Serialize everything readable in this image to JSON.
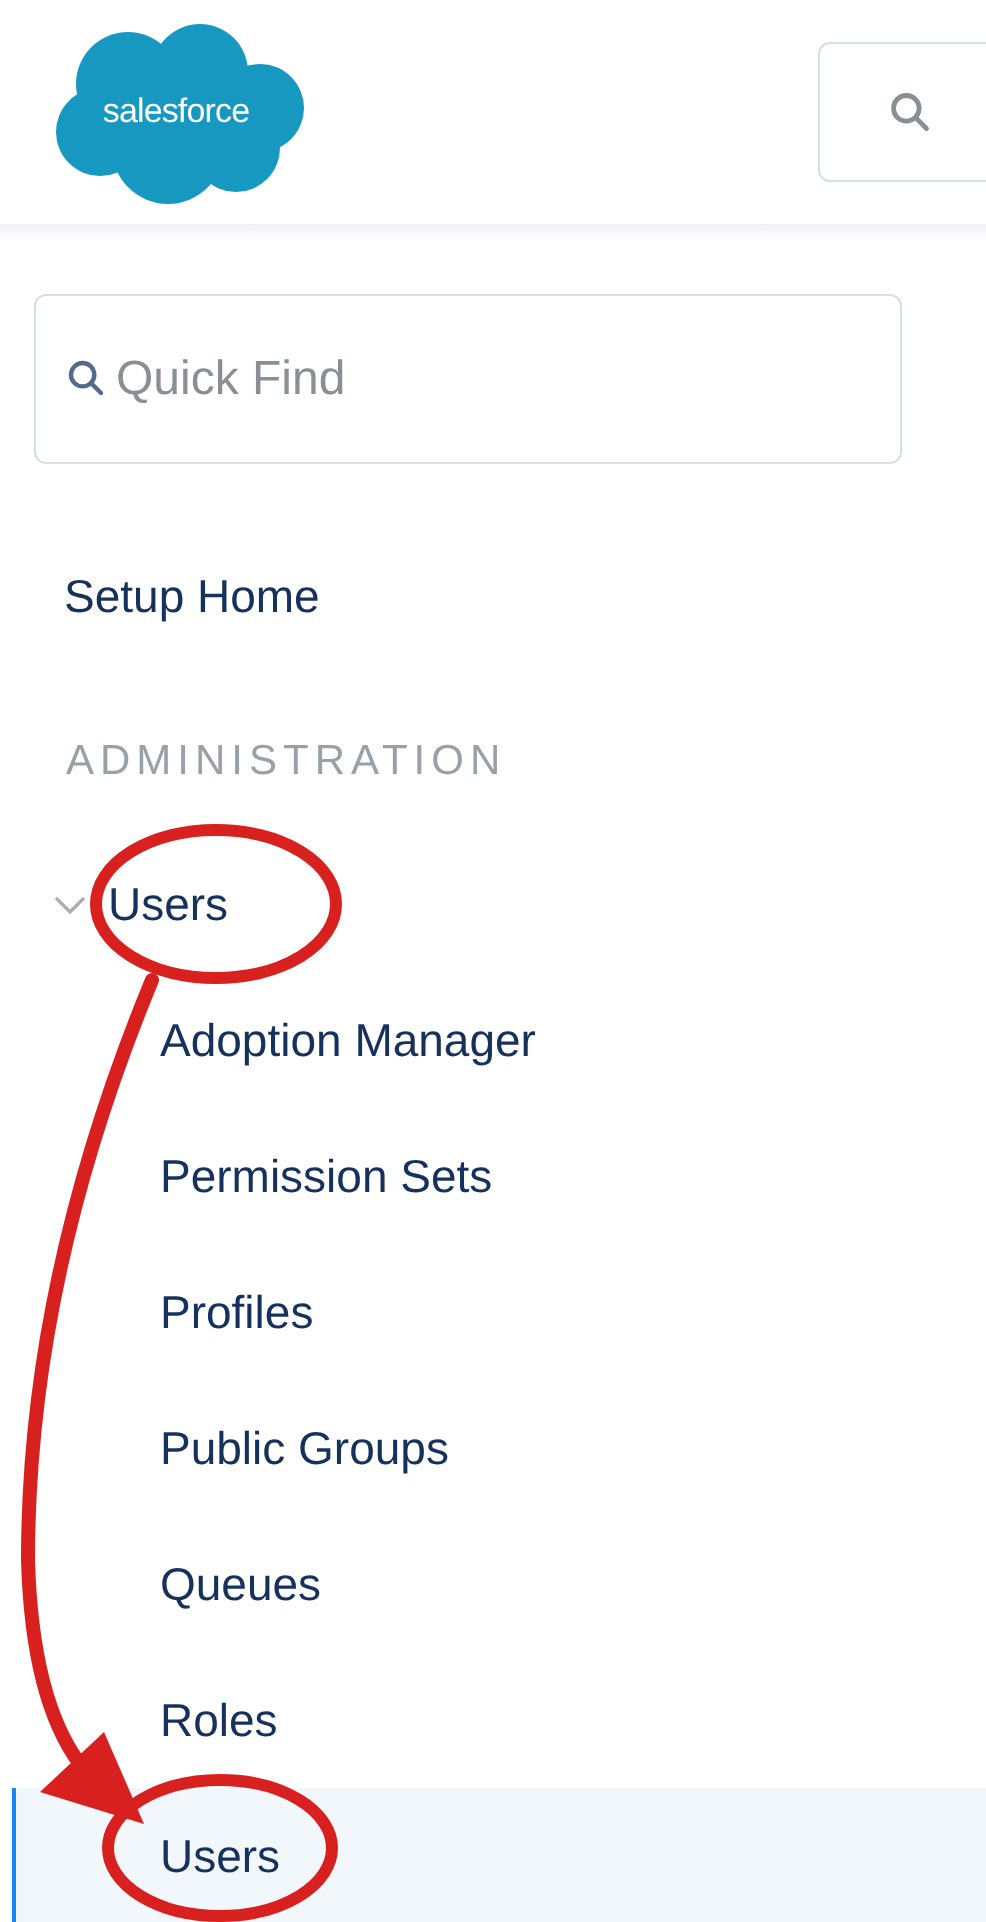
{
  "header": {
    "logo": "salesforce"
  },
  "quick_find": {
    "placeholder": "Quick Find"
  },
  "nav": [
    {
      "label": "Setup Home",
      "selected": false
    }
  ],
  "section": "ADMINISTRATION",
  "tree": [
    {
      "label": "Users",
      "expanded": true,
      "children": [
        {
          "label": "Adoption Manager",
          "selected": false
        },
        {
          "label": "Permission Sets",
          "selected": false
        },
        {
          "label": "Profiles",
          "selected": false
        },
        {
          "label": "Public Groups",
          "selected": false
        },
        {
          "label": "Queues",
          "selected": false
        },
        {
          "label": "Roles",
          "selected": false
        },
        {
          "label": "Users",
          "selected": true
        }
      ]
    }
  ]
}
